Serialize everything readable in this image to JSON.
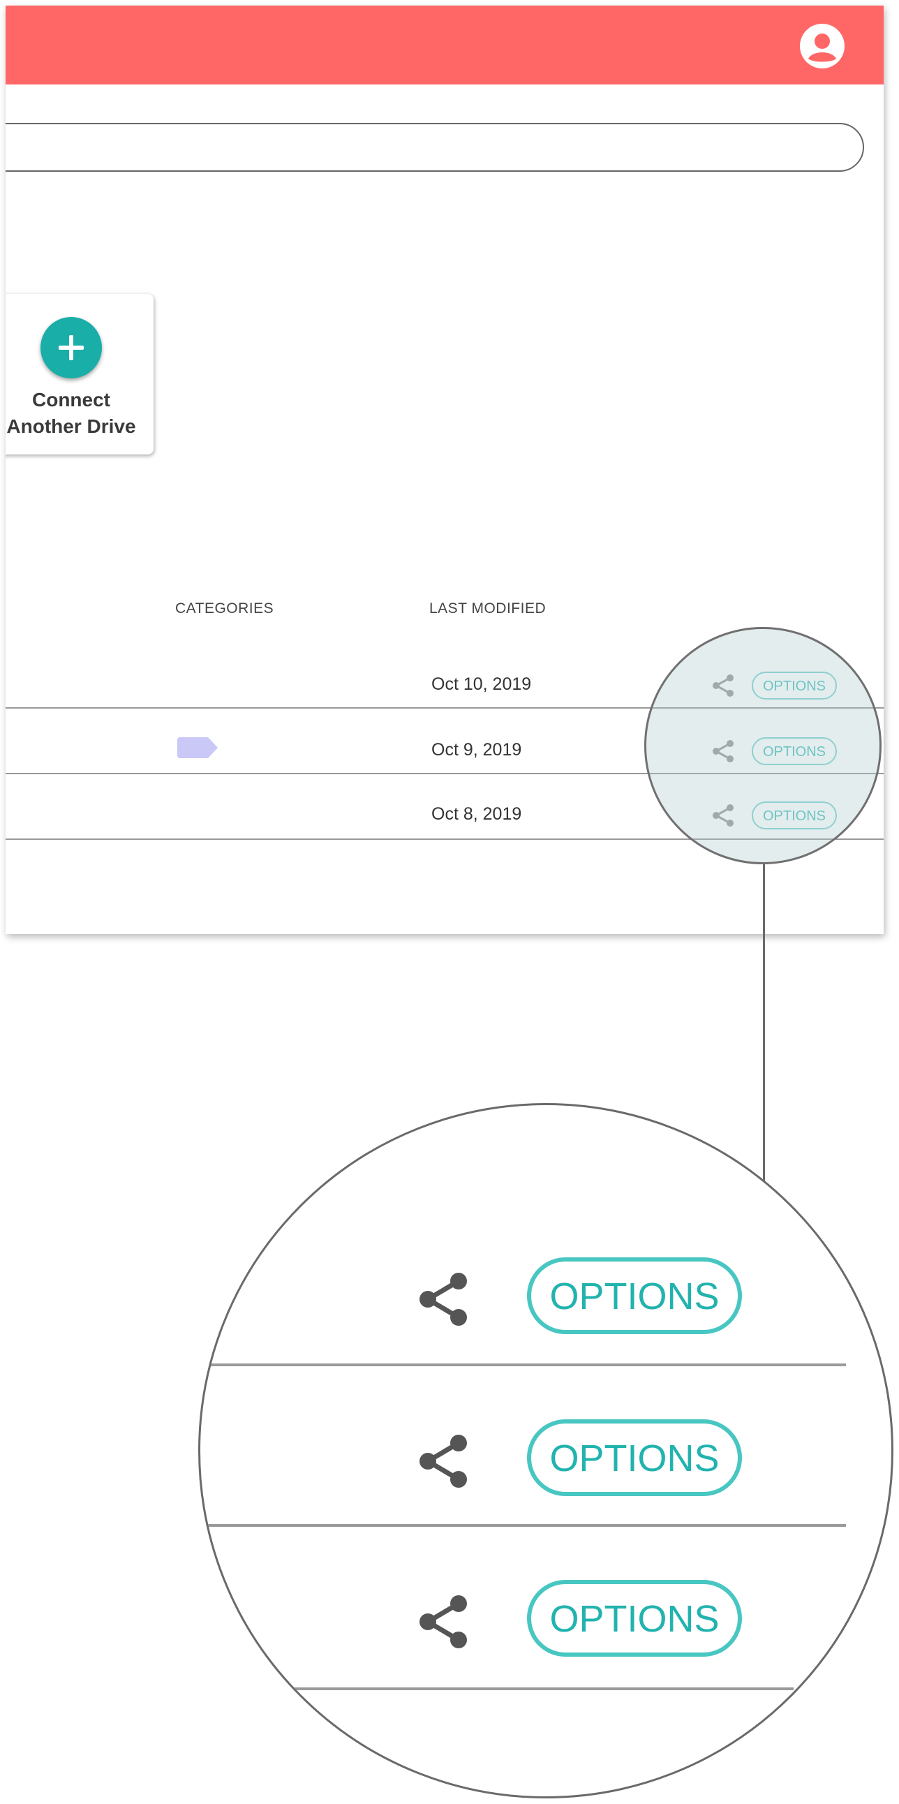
{
  "header": {
    "account_icon": "account-circle-icon"
  },
  "search": {
    "value": ""
  },
  "connect_card": {
    "label_line1": "Connect",
    "label_line2": "Another Drive",
    "icon": "plus-icon"
  },
  "table": {
    "headers": {
      "categories": "CATEGORIES",
      "last_modified": "LAST MODIFIED"
    },
    "rows": [
      {
        "date": "Oct 10, 2019",
        "has_category": false,
        "options_label": "OPTIONS",
        "share_icon": "share-icon"
      },
      {
        "date": "Oct 9, 2019",
        "has_category": true,
        "options_label": "OPTIONS",
        "share_icon": "share-icon"
      },
      {
        "date": "Oct 8, 2019",
        "has_category": false,
        "options_label": "OPTIONS",
        "share_icon": "share-icon"
      }
    ]
  },
  "magnifier": {
    "rows": [
      {
        "options_label": "OPTIONS",
        "share_icon": "share-icon"
      },
      {
        "options_label": "OPTIONS",
        "share_icon": "share-icon"
      },
      {
        "options_label": "OPTIONS",
        "share_icon": "share-icon"
      }
    ]
  },
  "colors": {
    "header_bg": "#ff6666",
    "accent_teal": "#1aaea8",
    "category_tag": "#c9c8f7",
    "lens_tint": "#b0cbcf"
  }
}
